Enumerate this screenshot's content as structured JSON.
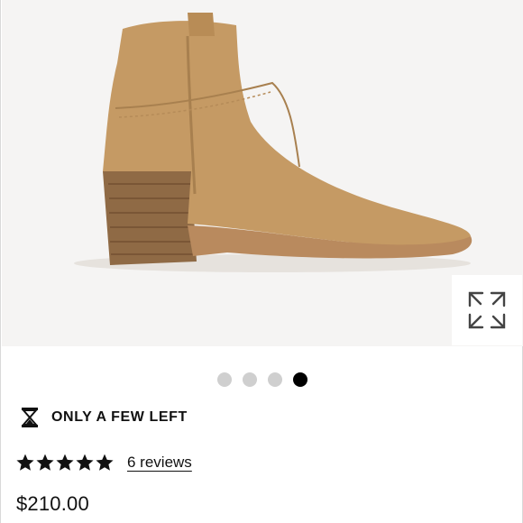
{
  "product": {
    "image_alt": "Tan suede western ankle boot with stacked wooden heel",
    "stock_status": "ONLY A FEW LEFT",
    "rating": 5,
    "rating_max": 5,
    "reviews_label": "6 reviews",
    "price": "$210.00"
  },
  "carousel": {
    "count": 4,
    "active_index": 3
  },
  "icons": {
    "expand": "expand-arrows-icon",
    "stock": "hourglass-icon",
    "star": "star-icon"
  },
  "colors": {
    "suede": "#c59a64",
    "heel": "#8f6a45",
    "sole": "#b98a5e",
    "dot_inactive": "#cfcfcf",
    "dot_active": "#000000"
  }
}
